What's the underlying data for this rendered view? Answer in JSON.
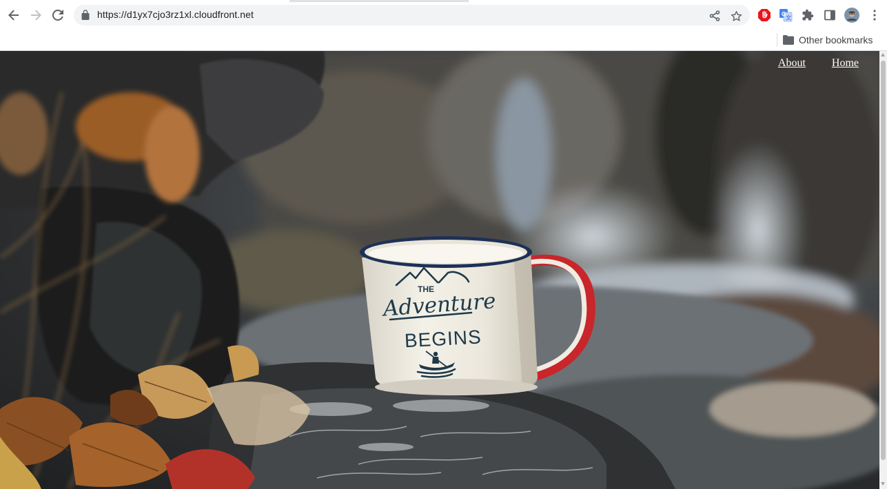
{
  "browser": {
    "url": "https://d1yx7cjo3rz1xl.cloudfront.net",
    "bookmarks": {
      "other_label": "Other bookmarks"
    },
    "icons": [
      "back-arrow-icon",
      "forward-arrow-icon",
      "reload-icon",
      "lock-icon",
      "share-icon",
      "star-icon",
      "adblock-icon",
      "translate-icon",
      "extensions-puzzle-icon",
      "side-panel-icon",
      "profile-avatar",
      "more-vert-icon",
      "folder-icon"
    ]
  },
  "page": {
    "nav": {
      "about": "About",
      "home": "Home"
    },
    "hero": {
      "image_subject": "enamel camping mug on a wet rock by a stream",
      "mug_text": {
        "line1": "THE",
        "line2": "Adventure",
        "line3": "BEGINS"
      }
    }
  },
  "colors": {
    "mug_rim": "#1d3156",
    "mug_handle": "#c8262a",
    "mug_ink": "#1e3a4a",
    "nav_text": "#ffffff"
  }
}
